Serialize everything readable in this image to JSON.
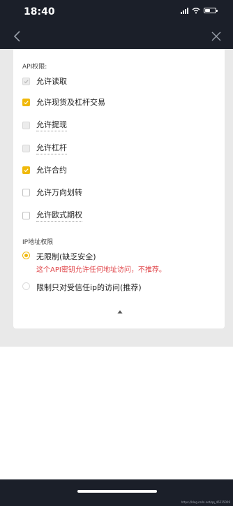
{
  "status_bar": {
    "time": "18:40"
  },
  "permissions": {
    "section_title": "API权限:",
    "items": [
      {
        "label": "允许读取",
        "state": "disabled-checked"
      },
      {
        "label": "允许现货及杠杆交易",
        "state": "checked"
      },
      {
        "label": "允许提现",
        "state": "unchecked"
      },
      {
        "label": "允许杠杆",
        "state": "unchecked"
      },
      {
        "label": "允许合约",
        "state": "checked"
      },
      {
        "label": "允许万向划转",
        "state": "unchecked"
      },
      {
        "label": "允许欧式期权",
        "state": "unchecked"
      }
    ]
  },
  "ip": {
    "section_title": "IP地址权限",
    "options": [
      {
        "label": "无限制(缺乏安全)",
        "warning": "这个API密钥允许任何地址访问，不推荐。",
        "selected": true
      },
      {
        "label": "限制只对受信任ip的访问(推荐)",
        "selected": false
      }
    ]
  },
  "footer": {
    "watermark": "https://blog.csdn.net/qq_46215009"
  },
  "colors": {
    "accent": "#f0b90b",
    "warning": "#e0464a",
    "nav": "#1b1f29"
  },
  "icons": {
    "back": "chevron-left-icon",
    "close": "close-icon",
    "collapse": "caret-up-icon"
  }
}
